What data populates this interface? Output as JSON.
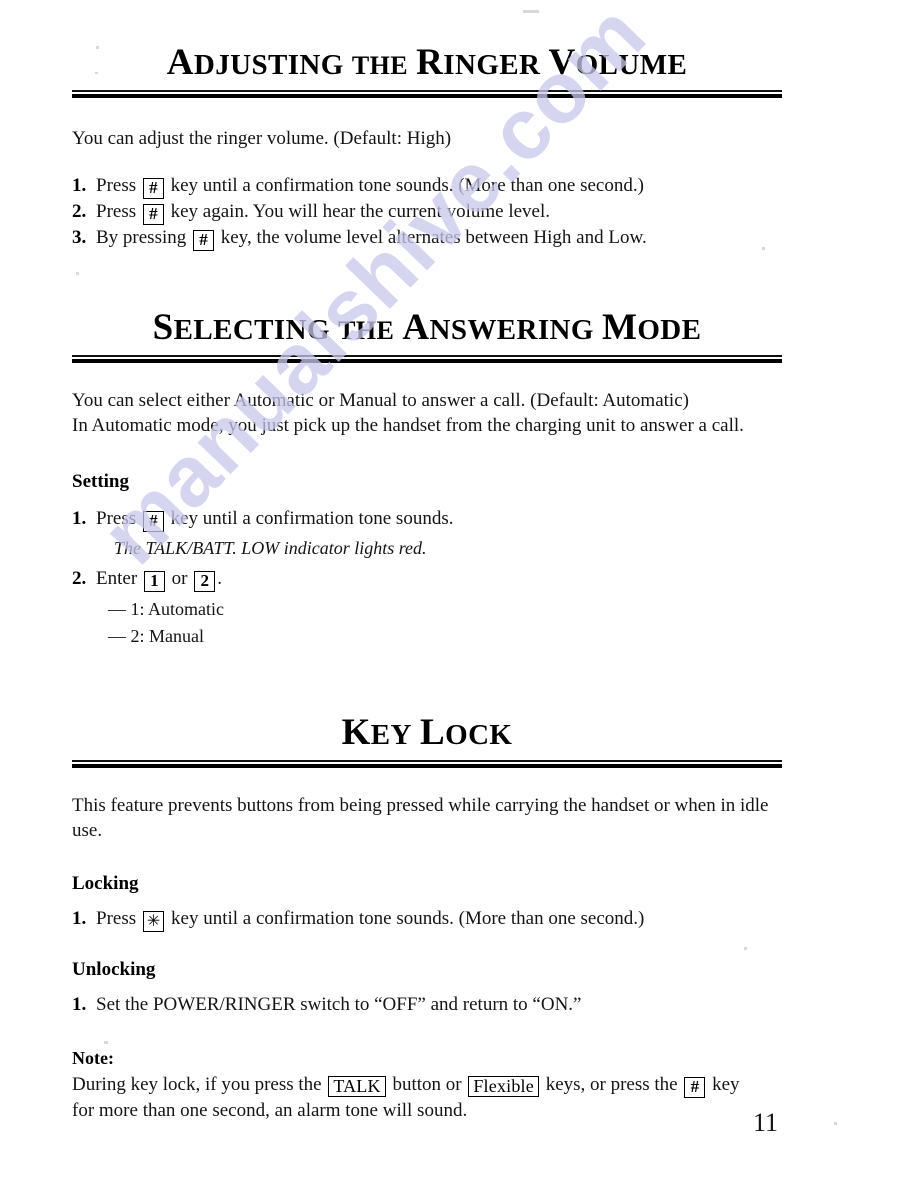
{
  "document": {
    "page_number": "11",
    "watermark": "manualshive.com",
    "watermark_color": "#c8c8ec"
  },
  "sections": [
    {
      "id": "adjusting-ringer-volume",
      "title_parts": [
        {
          "cap": "A",
          "rest": "DJUSTING"
        },
        {
          "cap": "T",
          "rest": "HE"
        },
        {
          "cap": "R",
          "rest": "INGER"
        },
        {
          "cap": "V",
          "rest": "OLUME"
        }
      ],
      "title_plain": "ADJUSTING THE RINGER VOLUME",
      "intro": "You can adjust the ringer volume.   (Default: High)",
      "steps": [
        {
          "num": "1.",
          "before": "Press",
          "key": "#",
          "after": "key until a confirmation tone sounds. (More than one second.)"
        },
        {
          "num": "2.",
          "before": "Press",
          "key": "#",
          "after": "key again.  You will hear the current volume level."
        },
        {
          "num": "3.",
          "before": "By pressing",
          "key": "#",
          "after": "key, the volume level alternates between High and Low."
        }
      ]
    },
    {
      "id": "selecting-answering-mode",
      "title_parts": [
        {
          "cap": "S",
          "rest": "ELECTING"
        },
        {
          "cap": "T",
          "rest": "HE"
        },
        {
          "cap": "A",
          "rest": "NSWERING"
        },
        {
          "cap": "M",
          "rest": "ODE"
        }
      ],
      "title_plain": "SELECTING THE ANSWERING MODE",
      "intro_line1": "You can select either Automatic or Manual to answer a call.  (Default: Automatic)",
      "intro_line2": "In Automatic mode, you just pick up the handset from the charging unit to answer a call.",
      "subhead": "Setting",
      "step1": {
        "num": "1.",
        "before": "Press",
        "key": "#",
        "after": "key until a confirmation tone sounds."
      },
      "step1_note": "The TALK/BATT. LOW indicator lights red.",
      "step2": {
        "num": "2.",
        "before": "Enter",
        "key1": "1",
        "middle": "or",
        "key2": "2",
        "after": "."
      },
      "options": [
        "— 1: Automatic",
        "— 2: Manual"
      ]
    },
    {
      "id": "key-lock",
      "title_parts": [
        {
          "cap": "K",
          "rest": "EY"
        },
        {
          "cap": "L",
          "rest": "OCK"
        }
      ],
      "title_plain": "KEY LOCK",
      "intro": "This feature prevents buttons from being pressed while carrying the handset or when in idle use.",
      "locking": {
        "subhead": "Locking",
        "step": {
          "num": "1.",
          "before": "Press",
          "key": "✳",
          "after": "key until a confirmation tone sounds. (More than one second.)"
        }
      },
      "unlocking": {
        "subhead": "Unlocking",
        "step": {
          "num": "1.",
          "text": "Set the POWER/RINGER switch to “OFF” and return to “ON.”"
        }
      },
      "note": {
        "subhead": "Note:",
        "part1": "During key lock, if you press the",
        "key1": "TALK",
        "part2": "button or",
        "key2": "Flexible",
        "part3": "keys, or press the",
        "key3": "#",
        "part4": "key",
        "line2": "for more than one second, an alarm tone will sound."
      }
    }
  ]
}
